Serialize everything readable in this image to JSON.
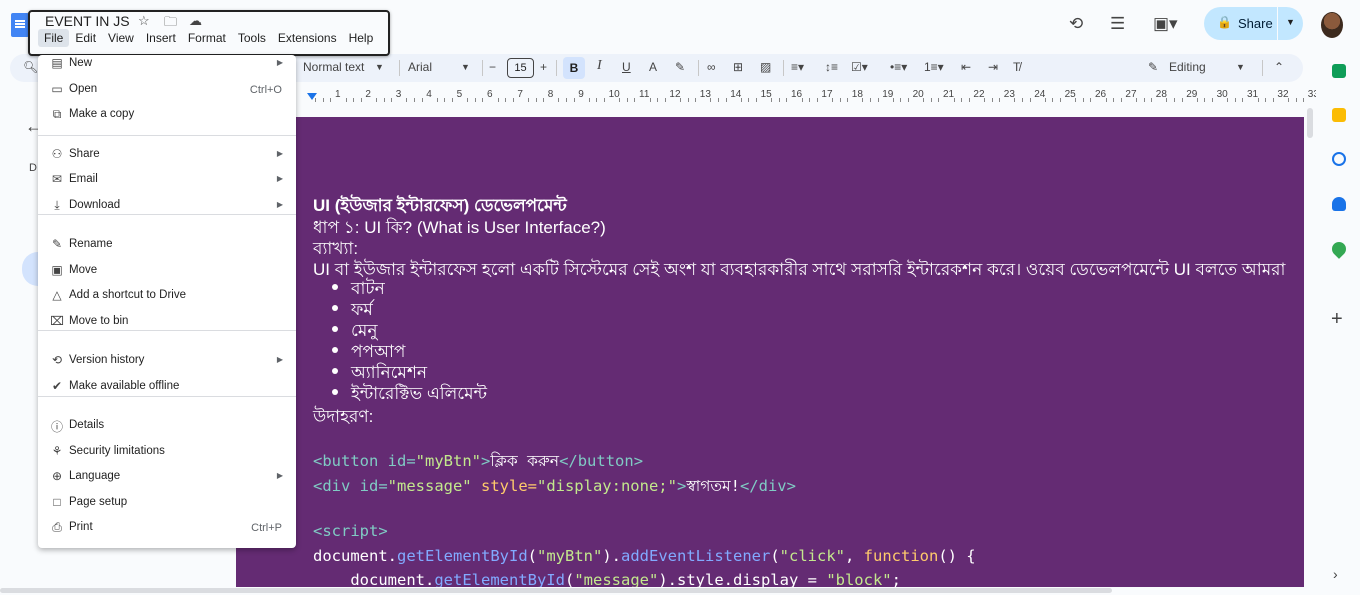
{
  "app": {
    "doc_title": "EVENT IN JS",
    "menubar": [
      "File",
      "Edit",
      "View",
      "Insert",
      "Format",
      "Tools",
      "Extensions",
      "Help"
    ],
    "share_label": "Share"
  },
  "toolbar": {
    "style": "Normal text",
    "font": "Arial",
    "font_size": "15",
    "mode": "Editing"
  },
  "ruler": {
    "numbers": [
      "1",
      "2",
      "3",
      "4",
      "5",
      "6",
      "7",
      "8",
      "9",
      "10",
      "11",
      "12",
      "13",
      "14",
      "15",
      "16",
      "17",
      "18",
      "19",
      "20",
      "21",
      "22",
      "23",
      "24",
      "25",
      "26",
      "27",
      "28",
      "29",
      "30",
      "31",
      "32",
      "33"
    ]
  },
  "side_panel": {
    "label": "D"
  },
  "file_menu": {
    "items": [
      {
        "label": "New",
        "icon": "new-doc-icon",
        "submenu": true
      },
      {
        "label": "Open",
        "icon": "folder-open-icon",
        "shortcut": "Ctrl+O"
      },
      {
        "label": "Make a copy",
        "icon": "copy-icon"
      },
      {
        "label": "Share",
        "icon": "person-add-icon",
        "submenu": true
      },
      {
        "label": "Email",
        "icon": "mail-icon",
        "submenu": true
      },
      {
        "label": "Download",
        "icon": "download-icon",
        "submenu": true
      },
      {
        "label": "Rename",
        "icon": "pencil-icon"
      },
      {
        "label": "Move",
        "icon": "move-folder-icon"
      },
      {
        "label": "Add a shortcut to Drive",
        "icon": "drive-shortcut-icon"
      },
      {
        "label": "Move to bin",
        "icon": "trash-icon"
      },
      {
        "label": "Version history",
        "icon": "history-icon",
        "submenu": true
      },
      {
        "label": "Make available offline",
        "icon": "offline-check-icon"
      },
      {
        "label": "Details",
        "icon": "info-icon"
      },
      {
        "label": "Security limitations",
        "icon": "security-icon"
      },
      {
        "label": "Language",
        "icon": "globe-icon",
        "submenu": true
      },
      {
        "label": "Page setup",
        "icon": "page-icon"
      },
      {
        "label": "Print",
        "icon": "printer-icon",
        "shortcut": "Ctrl+P"
      }
    ]
  },
  "document": {
    "heading": "UI (ইউজার ইন্টারফেস) ডেভেলপমেন্ট",
    "step": "ধাপ ১: UI কি? (What is User Interface?)",
    "explain_label": "ব্যাখ্যা:",
    "paragraph": "UI বা ইউজার ইন্টারফেস হলো একটি সিস্টেমের সেই অংশ যা ব্যবহারকারীর সাথে সরাসরি ইন্টারেকশন করে। ওয়েব ডেভেলপমেন্টে UI বলতে আমরা",
    "bullets": [
      "বাটন",
      "ফর্ম",
      "মেনু",
      "পপআপ",
      "অ্যানিমেশন",
      "ইন্টারেক্টিভ এলিমেন্ট"
    ],
    "example_label": "উদাহরণ:",
    "code": {
      "l1_open": "<button id=",
      "l1_val": "\"myBtn\"",
      "l1_gt": ">",
      "l1_text": "ক্লিক করুন",
      "l1_close": "</button>",
      "l2_open": "<div id=",
      "l2_val": "\"message\"",
      "l2_style": " style=",
      "l2_style_val": "\"display:none;\"",
      "l2_gt": ">",
      "l2_text": "স্বাগতম!",
      "l2_close": "</div>",
      "l3": "<script>",
      "l4_a": "document.",
      "l4_b": "getElementById",
      "l4_c": "(",
      "l4_d": "\"myBtn\"",
      "l4_e": ").",
      "l4_f": "addEventListener",
      "l4_g": "(",
      "l4_h": "\"click\"",
      "l4_i": ", ",
      "l4_j": "function",
      "l4_k": "() {",
      "l5_a": "    document.",
      "l5_b": "getElementById",
      "l5_c": "(",
      "l5_d": "\"message\"",
      "l5_e": ").style.display = ",
      "l5_f": "\"block\"",
      "l5_g": ";"
    }
  }
}
